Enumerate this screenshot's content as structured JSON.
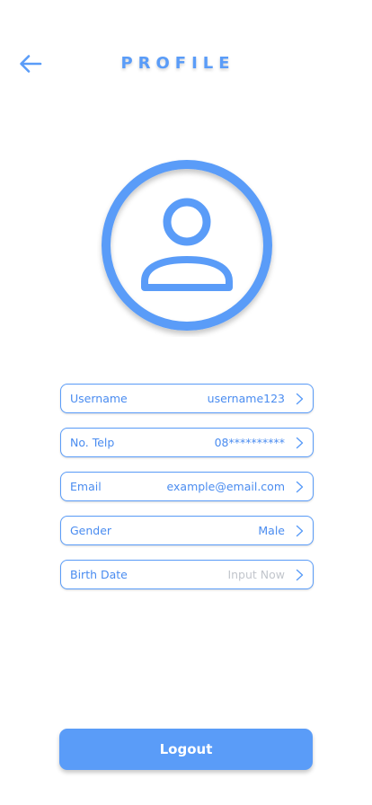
{
  "header": {
    "title": "PROFILE",
    "back_icon": "arrow-left-icon"
  },
  "avatar": {
    "icon": "user-icon"
  },
  "fields": [
    {
      "label": "Username",
      "value": "username123",
      "placeholder": false
    },
    {
      "label": "No. Telp",
      "value": "08**********",
      "placeholder": false
    },
    {
      "label": "Email",
      "value": "example@email.com",
      "placeholder": false
    },
    {
      "label": "Gender",
      "value": "Male",
      "placeholder": false
    },
    {
      "label": "Birth Date",
      "value": "Input Now",
      "placeholder": true
    }
  ],
  "logout": {
    "label": "Logout"
  },
  "colors": {
    "accent": "#5a9cf8",
    "placeholder_text": "#c2c6cc",
    "background": "#ffffff"
  }
}
